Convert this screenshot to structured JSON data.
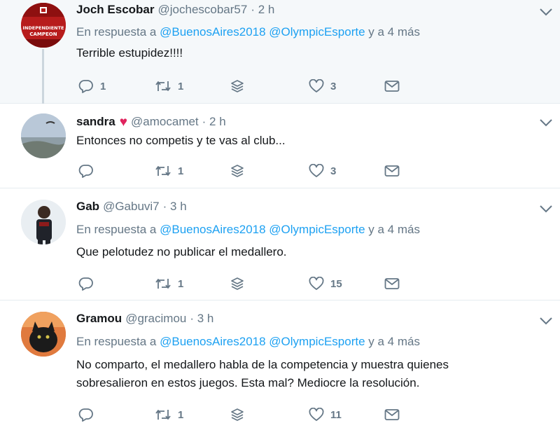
{
  "tweets": [
    {
      "name": "Joch Escobar",
      "handle": "@jochescobar57",
      "time": "· 2 h",
      "reply_prefix": "En respuesta a",
      "mention1": "@BuenosAires2018",
      "mention2": "@OlympicEsporte",
      "reply_suffix": "y a 4 más",
      "text": "Terrible estupidez!!!!",
      "replies": "1",
      "retweets": "1",
      "likes": "3",
      "avatar_text": [
        "INDEPENDIENTE",
        "CAMPEON"
      ]
    },
    {
      "name": "sandra",
      "handle": "@amocamet",
      "time": "· 2 h",
      "text": "Entonces no competis y te vas al club...",
      "replies": "",
      "retweets": "1",
      "likes": "3"
    },
    {
      "name": "Gab",
      "handle": "@Gabuvi7",
      "time": "· 3 h",
      "reply_prefix": "En respuesta a",
      "mention1": "@BuenosAires2018",
      "mention2": "@OlympicEsporte",
      "reply_suffix": "y a 4 más",
      "text": "Que pelotudez no publicar el medallero.",
      "replies": "",
      "retweets": "1",
      "likes": "15"
    },
    {
      "name": "Gramou",
      "handle": "@gracimou",
      "time": "· 3 h",
      "reply_prefix": "En respuesta a",
      "mention1": "@BuenosAires2018",
      "mention2": "@OlympicEsporte",
      "reply_suffix": "y a 4 más",
      "text_line1": "No comparto, el medallero habla de la competencia y muestra quienes",
      "text_line2": "sobresalieron en estos juegos.  Esta mal? Mediocre la resolución.",
      "replies": "",
      "retweets": "1",
      "likes": "11"
    }
  ],
  "colors": {
    "link": "#1da1f2",
    "muted": "#657786",
    "heart": "#e0245e",
    "highlight_bg": "#f5f8fa"
  },
  "icons": [
    "reply-icon",
    "retweet-icon",
    "stack-icon",
    "like-icon",
    "dm-icon",
    "chevron-down-icon"
  ]
}
